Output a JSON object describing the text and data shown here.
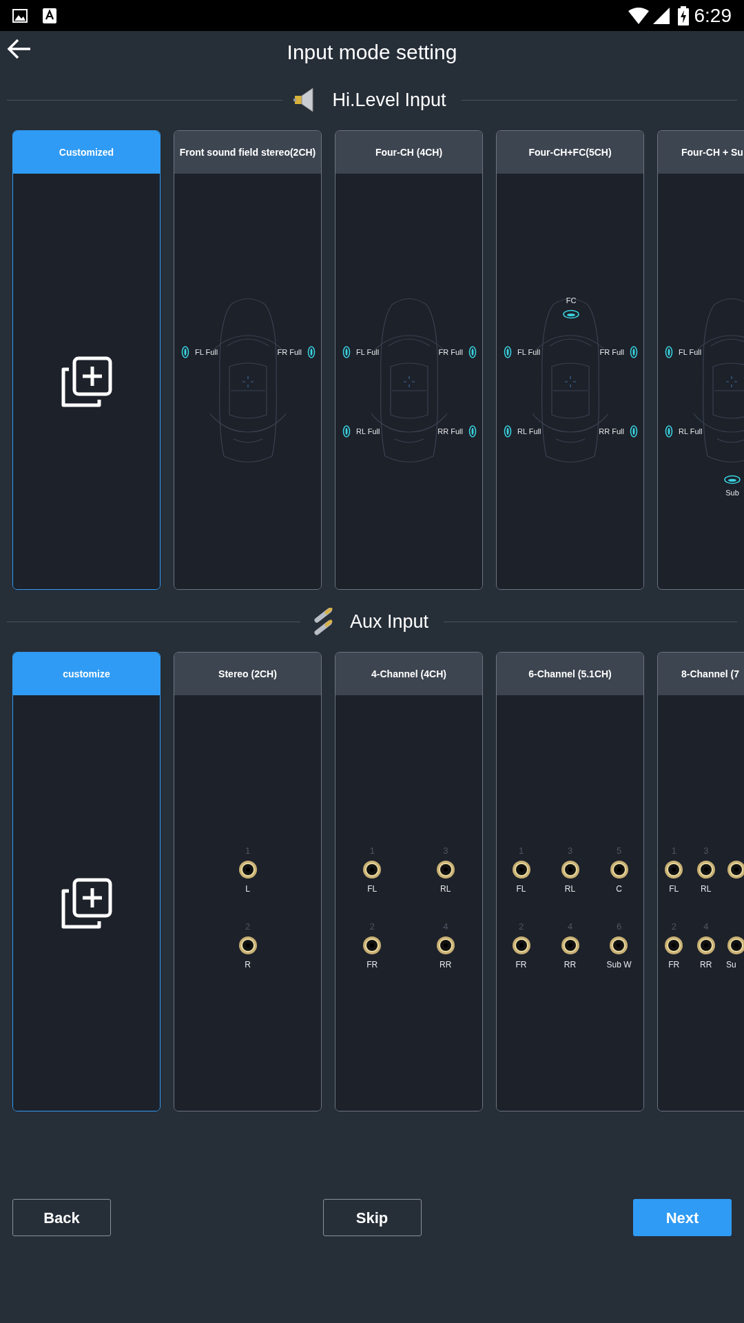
{
  "status_bar": {
    "time": "6:29"
  },
  "header": {
    "title": "Input mode setting"
  },
  "hi_level_input": {
    "title": "Hi.Level Input",
    "cards": [
      {
        "title": "Customized",
        "selected": true,
        "kind": "add",
        "cut_off": false
      },
      {
        "title": "Front sound field stereo(2CH)",
        "selected": false,
        "kind": "car",
        "cut_off": false,
        "speakers": [
          {
            "label": "FL Full",
            "kind": "fl"
          },
          {
            "label": "FR Full",
            "kind": "fr"
          }
        ]
      },
      {
        "title": "Four-CH (4CH)",
        "selected": false,
        "kind": "car",
        "cut_off": false,
        "speakers": [
          {
            "label": "FL Full",
            "kind": "fl"
          },
          {
            "label": "FR Full",
            "kind": "fr"
          },
          {
            "label": "RL Full",
            "kind": "rl"
          },
          {
            "label": "RR Full",
            "kind": "rr"
          }
        ]
      },
      {
        "title": "Four-CH+FC(5CH)",
        "selected": false,
        "kind": "car",
        "cut_off": false,
        "speakers": [
          {
            "label": "FC",
            "kind": "fc"
          },
          {
            "label": "FL Full",
            "kind": "fl"
          },
          {
            "label": "FR Full",
            "kind": "fr"
          },
          {
            "label": "RL Full",
            "kind": "rl"
          },
          {
            "label": "RR Full",
            "kind": "rr"
          }
        ]
      },
      {
        "title": "Four-CH + Su",
        "selected": false,
        "kind": "car",
        "cut_off": true,
        "speakers": [
          {
            "label": "FL Full",
            "kind": "fl"
          },
          {
            "label": "RL Full",
            "kind": "rl"
          },
          {
            "label": "Sub",
            "kind": "sub"
          }
        ]
      }
    ]
  },
  "aux_input": {
    "title": "Aux Input",
    "cards": [
      {
        "title": "customize",
        "selected": true,
        "kind": "add",
        "cut_off": false
      },
      {
        "title": "Stereo (2CH)",
        "selected": false,
        "kind": "jacks",
        "cut_off": false,
        "columns": [
          {
            "jacks": [
              {
                "kind": "jack",
                "number": "1",
                "label": "L"
              },
              {
                "kind": "jack",
                "number": "2",
                "label": "R"
              }
            ]
          }
        ]
      },
      {
        "title": "4-Channel (4CH)",
        "selected": false,
        "kind": "jacks",
        "cut_off": false,
        "columns": [
          {
            "jacks": [
              {
                "kind": "jack",
                "number": "1",
                "label": "FL"
              },
              {
                "kind": "jack",
                "number": "2",
                "label": "FR"
              }
            ]
          },
          {
            "jacks": [
              {
                "kind": "jack",
                "number": "3",
                "label": "RL"
              },
              {
                "kind": "jack",
                "number": "4",
                "label": "RR"
              }
            ]
          }
        ]
      },
      {
        "title": "6-Channel (5.1CH)",
        "selected": false,
        "kind": "jacks",
        "cut_off": false,
        "columns": [
          {
            "jacks": [
              {
                "kind": "jack",
                "number": "1",
                "label": "FL"
              },
              {
                "kind": "jack",
                "number": "2",
                "label": "FR"
              }
            ]
          },
          {
            "jacks": [
              {
                "kind": "jack",
                "number": "3",
                "label": "RL"
              },
              {
                "kind": "jack",
                "number": "4",
                "label": "RR"
              }
            ]
          },
          {
            "jacks": [
              {
                "kind": "jack",
                "number": "5",
                "label": "C"
              },
              {
                "kind": "jack",
                "number": "6",
                "label": "Sub W"
              }
            ]
          }
        ]
      },
      {
        "title": "8-Channel (7",
        "selected": false,
        "kind": "jacks",
        "cut_off": true,
        "columns": [
          {
            "jacks": [
              {
                "kind": "jack",
                "number": "1",
                "label": "FL"
              },
              {
                "kind": "jack",
                "number": "2",
                "label": "FR"
              }
            ]
          },
          {
            "jacks": [
              {
                "kind": "jack",
                "number": "3",
                "label": "RL"
              },
              {
                "kind": "jack",
                "number": "4",
                "label": "RR"
              }
            ]
          },
          {
            "jacks": [
              {
                "kind": "jack"
              },
              {
                "kind": "jack",
                "label": "Su"
              }
            ]
          }
        ]
      }
    ]
  },
  "buttons": [
    {
      "label": "Back",
      "primary": false
    },
    {
      "label": "Skip",
      "primary": false
    },
    {
      "label": "Next",
      "primary": true
    }
  ]
}
